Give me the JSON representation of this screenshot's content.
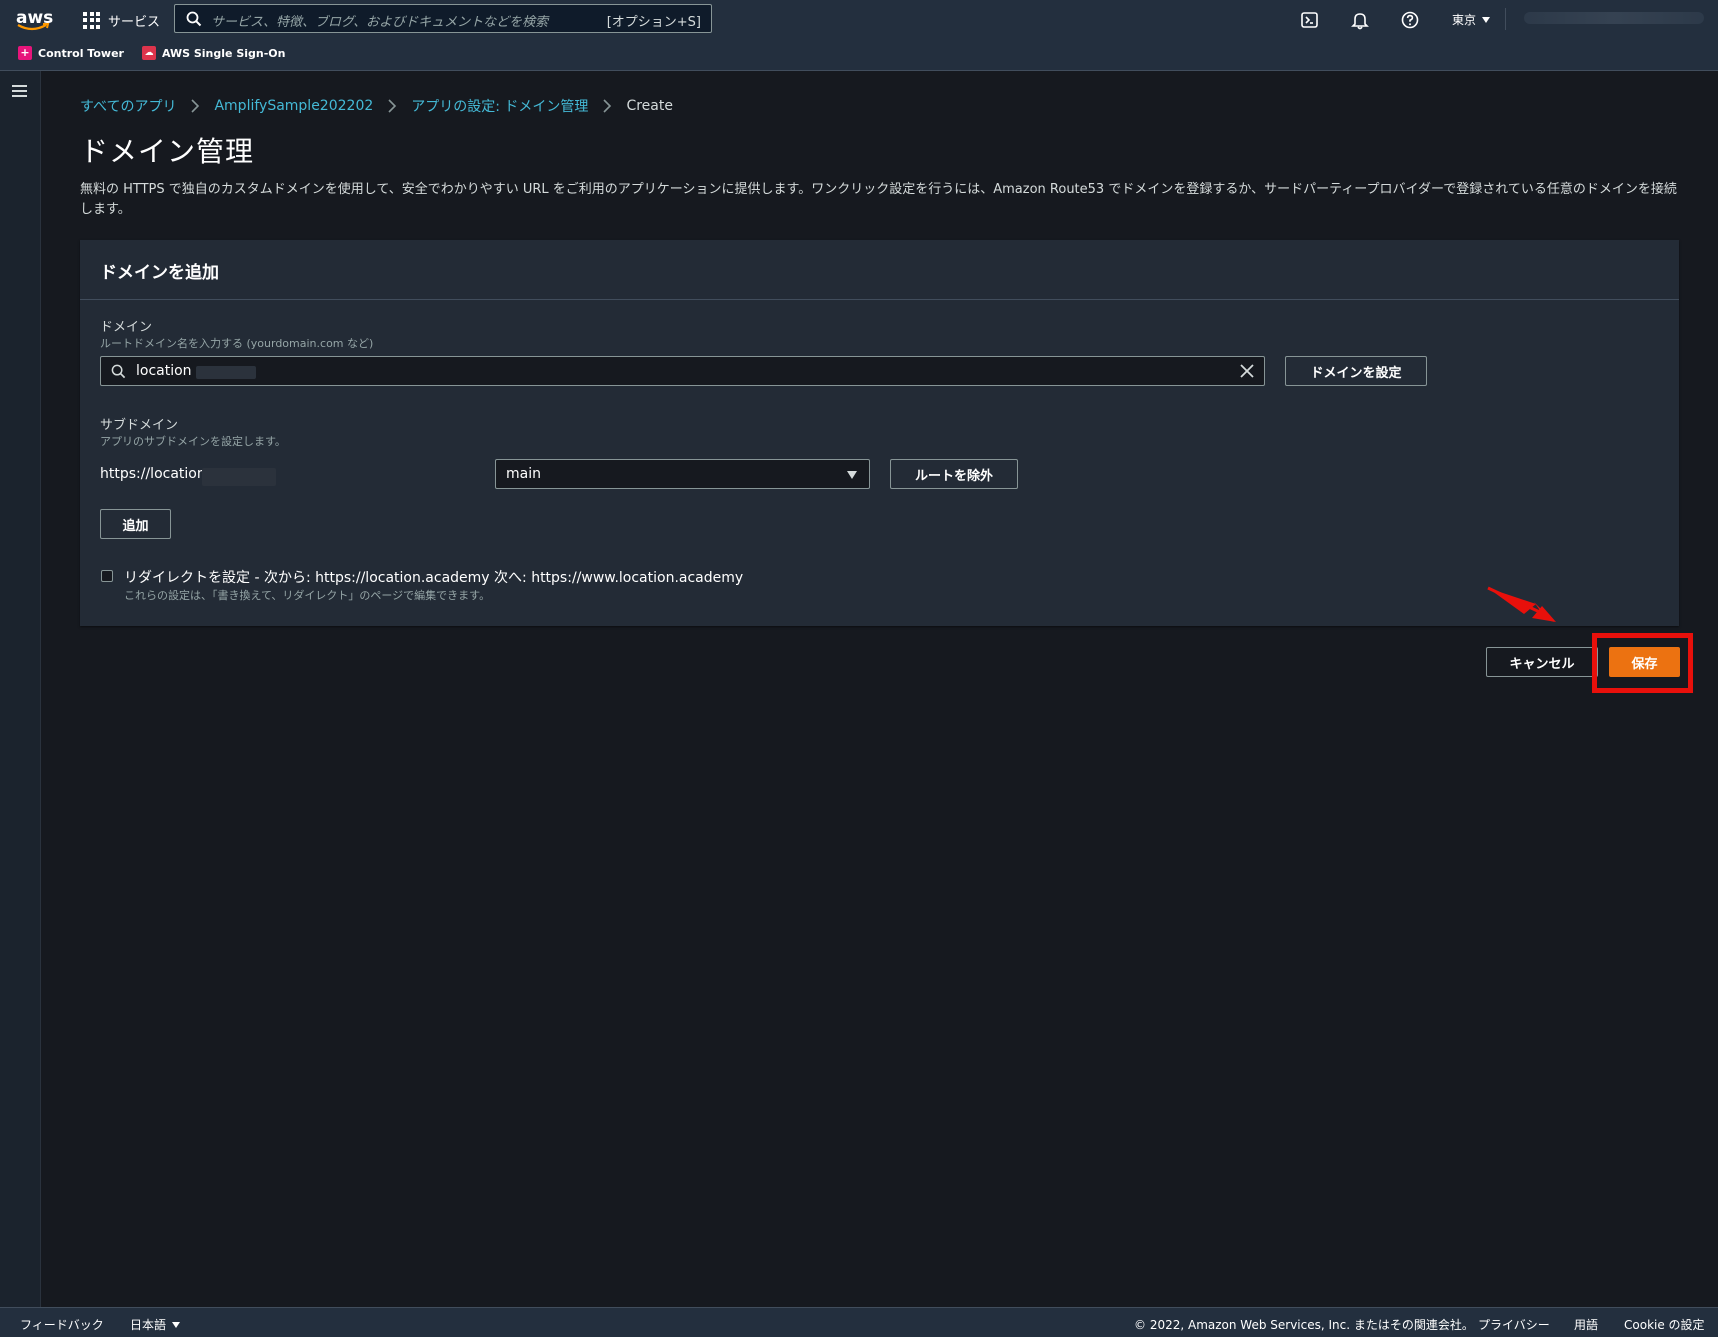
{
  "topnav": {
    "logo_text": "aws",
    "services_label": "サービス",
    "search_placeholder": "サービス、特徴、ブログ、およびドキュメントなどを検索",
    "search_shortcut": "[オプション+S]",
    "region": "東京",
    "favorites": [
      {
        "label": "Control Tower",
        "icon": "control-tower-icon",
        "color": "#e7157b"
      },
      {
        "label": "AWS Single Sign-On",
        "icon": "sso-icon",
        "color": "#dd344c"
      }
    ]
  },
  "breadcrumbs": [
    "すべてのアプリ",
    "AmplifySample202202",
    "アプリの設定: ドメイン管理",
    "Create"
  ],
  "page": {
    "title": "ドメイン管理",
    "description": "無料の HTTPS で独自のカスタムドメインを使用して、安全でわかりやすい URL をご利用のアプリケーションに提供します。ワンクリック設定を行うには、Amazon Route53 でドメインを登録するか、サードパーティープロバイダーで登録されている任意のドメインを接続します。"
  },
  "panel": {
    "title": "ドメインを追加",
    "domain_label": "ドメイン",
    "domain_hint": "ルートドメイン名を入力する (yourdomain.com など)",
    "domain_value": "location",
    "configure_button": "ドメインを設定",
    "subdomain_label": "サブドメイン",
    "subdomain_hint": "アプリのサブドメインを設定します。",
    "subdomain_prefix": "https://location",
    "branch_value": "main",
    "exclude_root_button": "ルートを除外",
    "add_button": "追加",
    "redirect_label": "リダイレクトを設定 - 次から: https://location.academy 次へ: https://www.location.academy",
    "redirect_hint": "これらの設定は、「書き換えて、リダイレクト」のページで編集できます。",
    "redirect_checked": false
  },
  "actions": {
    "cancel": "キャンセル",
    "save": "保存"
  },
  "footer": {
    "feedback": "フィードバック",
    "language": "日本語",
    "copyright": "© 2022, Amazon Web Services, Inc. またはその関連会社。",
    "privacy": "プライバシー",
    "terms": "用語",
    "cookie": "Cookie の設定"
  },
  "colors": {
    "accent": "#ec7211",
    "link": "#44b9d6",
    "highlight": "#e8100b",
    "background": "#16191f",
    "nav": "#232f3e"
  }
}
